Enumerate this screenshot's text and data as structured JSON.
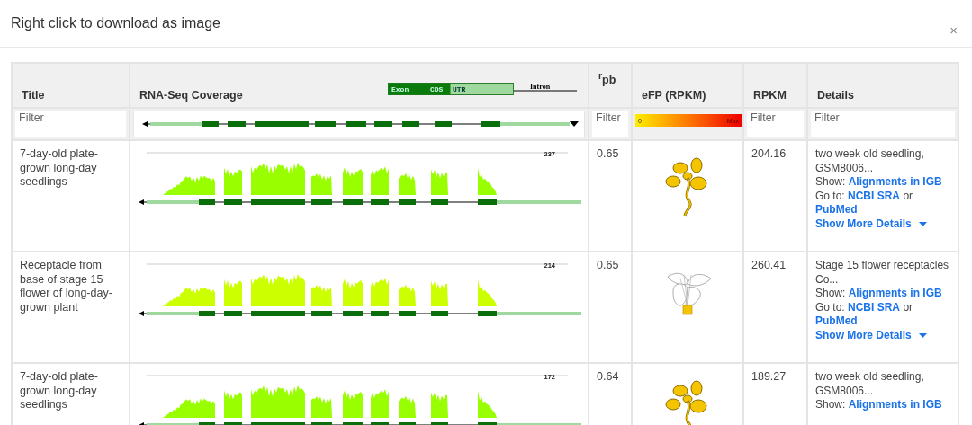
{
  "dialog": {
    "title": "Right click to download as image",
    "close": "×"
  },
  "table": {
    "columns": [
      {
        "label": "Title"
      },
      {
        "label": "RNA-Seq Coverage"
      },
      {
        "label": "$^{r}$pb"
      },
      {
        "label": "eFP (RPKM)"
      },
      {
        "label": "RPKM"
      },
      {
        "label": "Details"
      }
    ],
    "legend": {
      "exon": "Exon",
      "cds": "CDS",
      "utr": "UTR",
      "intron": "Intron"
    },
    "filters": {
      "title": {
        "placeholder": "Filter"
      },
      "rpb": {
        "placeholder": "Filter"
      },
      "rpkm": {
        "placeholder": "Filter"
      },
      "details": {
        "placeholder": "Filter"
      }
    },
    "efp_scale": {
      "min": "0",
      "max": "Max"
    },
    "rows": [
      {
        "title": "7-day-old plate-grown long-day seedlings",
        "max": "237",
        "color": "#99ff00",
        "rpb": "0.65",
        "efp": {
          "kind": "seedling"
        },
        "rpkm": "204.16",
        "details": {
          "description": "two week old seedling, GSM8006...",
          "show_label": "Show:",
          "show_link": "Alignments in IGB",
          "goto_label": "Go to:",
          "goto_links": [
            "NCBI SRA",
            "PubMed"
          ],
          "or": "or",
          "more": "Show More Details"
        }
      },
      {
        "title": "Receptacle from base of stage 15 flower of long-day-grown plant",
        "max": "214",
        "color": "#ccff00",
        "rpb": "0.65",
        "efp": {
          "kind": "flower"
        },
        "rpkm": "260.41",
        "details": {
          "description": "Stage 15 flower receptacles Co...",
          "show_label": "Show:",
          "show_link": "Alignments in IGB",
          "goto_label": "Go to:",
          "goto_links": [
            "NCBI SRA",
            "PubMed"
          ],
          "or": "or",
          "more": "Show More Details"
        }
      },
      {
        "title": "7-day-old plate-grown long-day seedlings",
        "max": "172",
        "color": "#99ff00",
        "rpb": "0.64",
        "efp": {
          "kind": "seedling"
        },
        "rpkm": "189.27",
        "details": {
          "description": "two week old seedling, GSM8006...",
          "show_label": "Show:",
          "show_link": "Alignments in IGB"
        }
      }
    ]
  }
}
